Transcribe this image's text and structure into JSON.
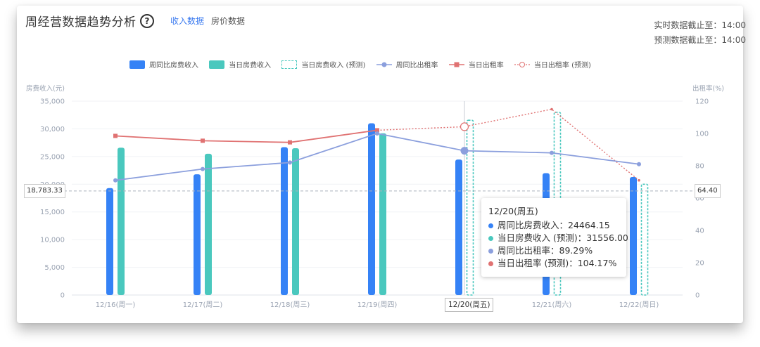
{
  "header": {
    "title": "周经营数据趋势分析",
    "help_icon": "?",
    "tabs": [
      {
        "label": "收入数据",
        "active": true
      },
      {
        "label": "房价数据",
        "active": false
      }
    ],
    "realtime_info": "实时数据截止至：14:00",
    "forecast_info": "预测数据截止至：14:00"
  },
  "legend": [
    {
      "label": "周同比房费收入",
      "kind": "bar",
      "color": "#3582f6"
    },
    {
      "label": "当日房费收入",
      "kind": "bar",
      "color": "#4ac8be"
    },
    {
      "label": "当日房费收入 (预测)",
      "kind": "bar-dashed",
      "color": "#4ac8be"
    },
    {
      "label": "周同比出租率",
      "kind": "line-circle",
      "color": "#8b9fdd"
    },
    {
      "label": "当日出租率",
      "kind": "line-square",
      "color": "#e07272"
    },
    {
      "label": "当日出租率 (预测)",
      "kind": "line-dotted",
      "color": "#e07272"
    }
  ],
  "chart_data": {
    "type": "bar",
    "categories": [
      "12/16(周一)",
      "12/17(周二)",
      "12/18(周三)",
      "12/19(周四)",
      "12/20(周五)",
      "12/21(周六)",
      "12/22(周日)"
    ],
    "ylabel": "房费收入(元)",
    "ylabel_right": "出租率(%)",
    "ylim": [
      0,
      35000
    ],
    "ylim_right": [
      0,
      120
    ],
    "yticks": [
      "0",
      "5,000",
      "10,000",
      "15,000",
      "20,000",
      "25,000",
      "30,000",
      "35,000"
    ],
    "yticks_right": [
      "0",
      "20",
      "40",
      "60",
      "80",
      "100",
      "120"
    ],
    "series": [
      {
        "name": "周同比房费收入",
        "kind": "bar",
        "axis": "left",
        "values": [
          19300,
          21800,
          26700,
          31000,
          24464.15,
          22000,
          21300
        ]
      },
      {
        "name": "当日房费收入",
        "kind": "bar",
        "axis": "left",
        "values": [
          26600,
          25500,
          26500,
          29200,
          null,
          null,
          null
        ]
      },
      {
        "name": "当日房费收入 (预测)",
        "kind": "bar-dashed",
        "axis": "left",
        "values": [
          null,
          null,
          null,
          null,
          31556.0,
          33000,
          20000
        ]
      },
      {
        "name": "周同比出租率",
        "kind": "line",
        "axis": "right",
        "values": [
          71,
          78,
          82,
          100,
          89.29,
          88,
          81
        ]
      },
      {
        "name": "当日出租率",
        "kind": "line",
        "axis": "right",
        "values": [
          98.5,
          95.5,
          94.5,
          102,
          null,
          null,
          null
        ]
      },
      {
        "name": "当日出租率 (预测)",
        "kind": "line-dotted",
        "axis": "right",
        "values": [
          null,
          null,
          null,
          102,
          104.17,
          115,
          71
        ]
      }
    ],
    "reference": {
      "left_value": "18,783.33",
      "right_value": "64.40"
    },
    "highlight_category": 4,
    "tooltip": {
      "date": "12/20(周五)",
      "rows": [
        {
          "label": "周同比房费收入：24464.15",
          "color": "#3582f6"
        },
        {
          "label": "当日房费收入 (预测)：31556.00",
          "color": "#4ac8be"
        },
        {
          "label": "周同比出租率：89.29%",
          "color": "#8b9fdd"
        },
        {
          "label": "当日出租率 (预测)：104.17%",
          "color": "#e07272"
        }
      ]
    }
  }
}
